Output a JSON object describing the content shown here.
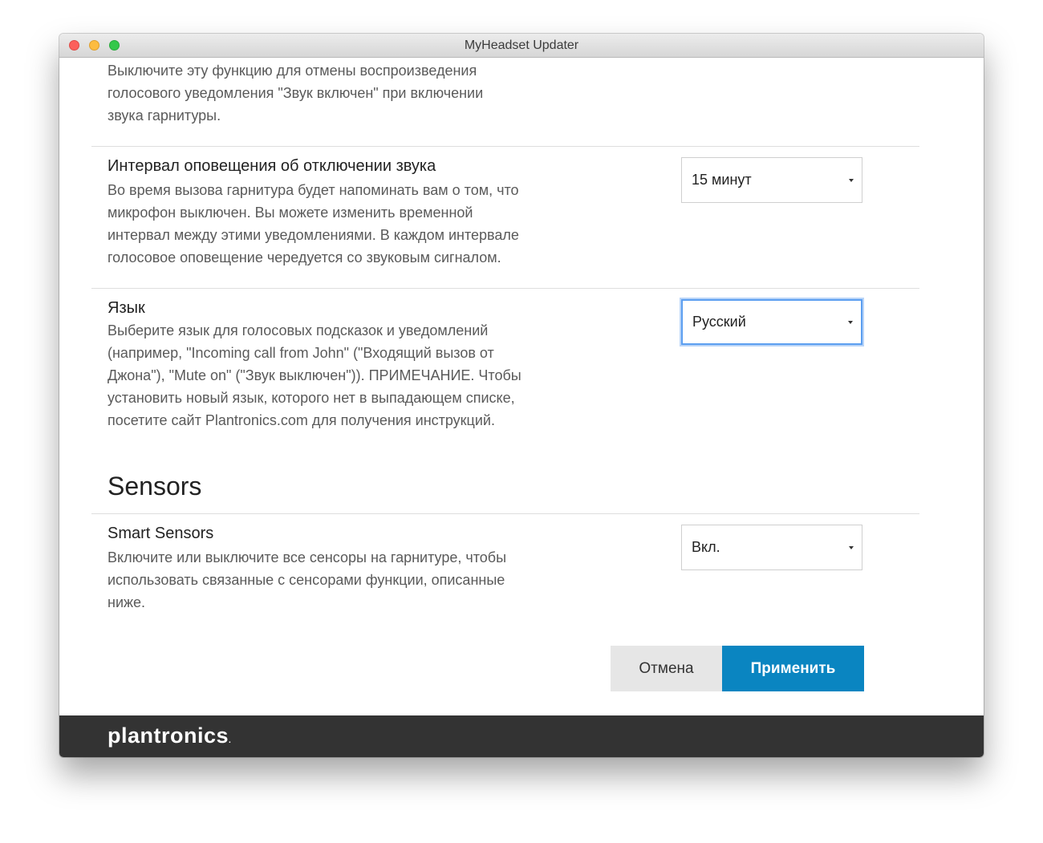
{
  "window": {
    "title": "MyHeadset Updater"
  },
  "mute_on_alert": {
    "desc_lines": [
      "Выключите эту функцию для отмены воспроизведения",
      "голосового уведомления \"Звук включен\" при включении",
      "звука гарнитуры."
    ]
  },
  "mute_interval": {
    "title": "Интервал оповещения об отключении звука",
    "desc_lines": [
      "Во время вызова гарнитура будет напоминать вам о том, что",
      "микрофон выключен. Вы можете изменить временной",
      "интервал между этими уведомлениями. В каждом интервале",
      "голосовое оповещение чередуется со звуковым сигналом."
    ],
    "selected": "15 минут"
  },
  "language": {
    "title": "Язык",
    "desc_lines": [
      "Выберите язык для голосовых подсказок и уведомлений",
      "(например, \"Incoming call from John\" (\"Входящий вызов от",
      "Джона\"), \"Mute on\" (\"Звук выключен\")). ПРИМЕЧАНИЕ. Чтобы",
      "установить новый язык, которого нет в выпадающем списке,",
      "посетите сайт Plantronics.com для получения инструкций."
    ],
    "selected": "Русский"
  },
  "sensors": {
    "section_title": "Sensors",
    "smart_sensors": {
      "title": "Smart Sensors",
      "desc_lines": [
        "Включите или выключите все сенсоры на гарнитуре, чтобы",
        "использовать связанные с сенсорами функции, описанные",
        "ниже."
      ],
      "selected": "Вкл."
    }
  },
  "actions": {
    "cancel_label": "Отмена",
    "apply_label": "Применить"
  },
  "footer": {
    "logo_text": "plantronics",
    "logo_mark": "."
  },
  "colors": {
    "accent": "#0a85c1",
    "footer_bg": "#333333",
    "focus": "#5b9ef0"
  }
}
